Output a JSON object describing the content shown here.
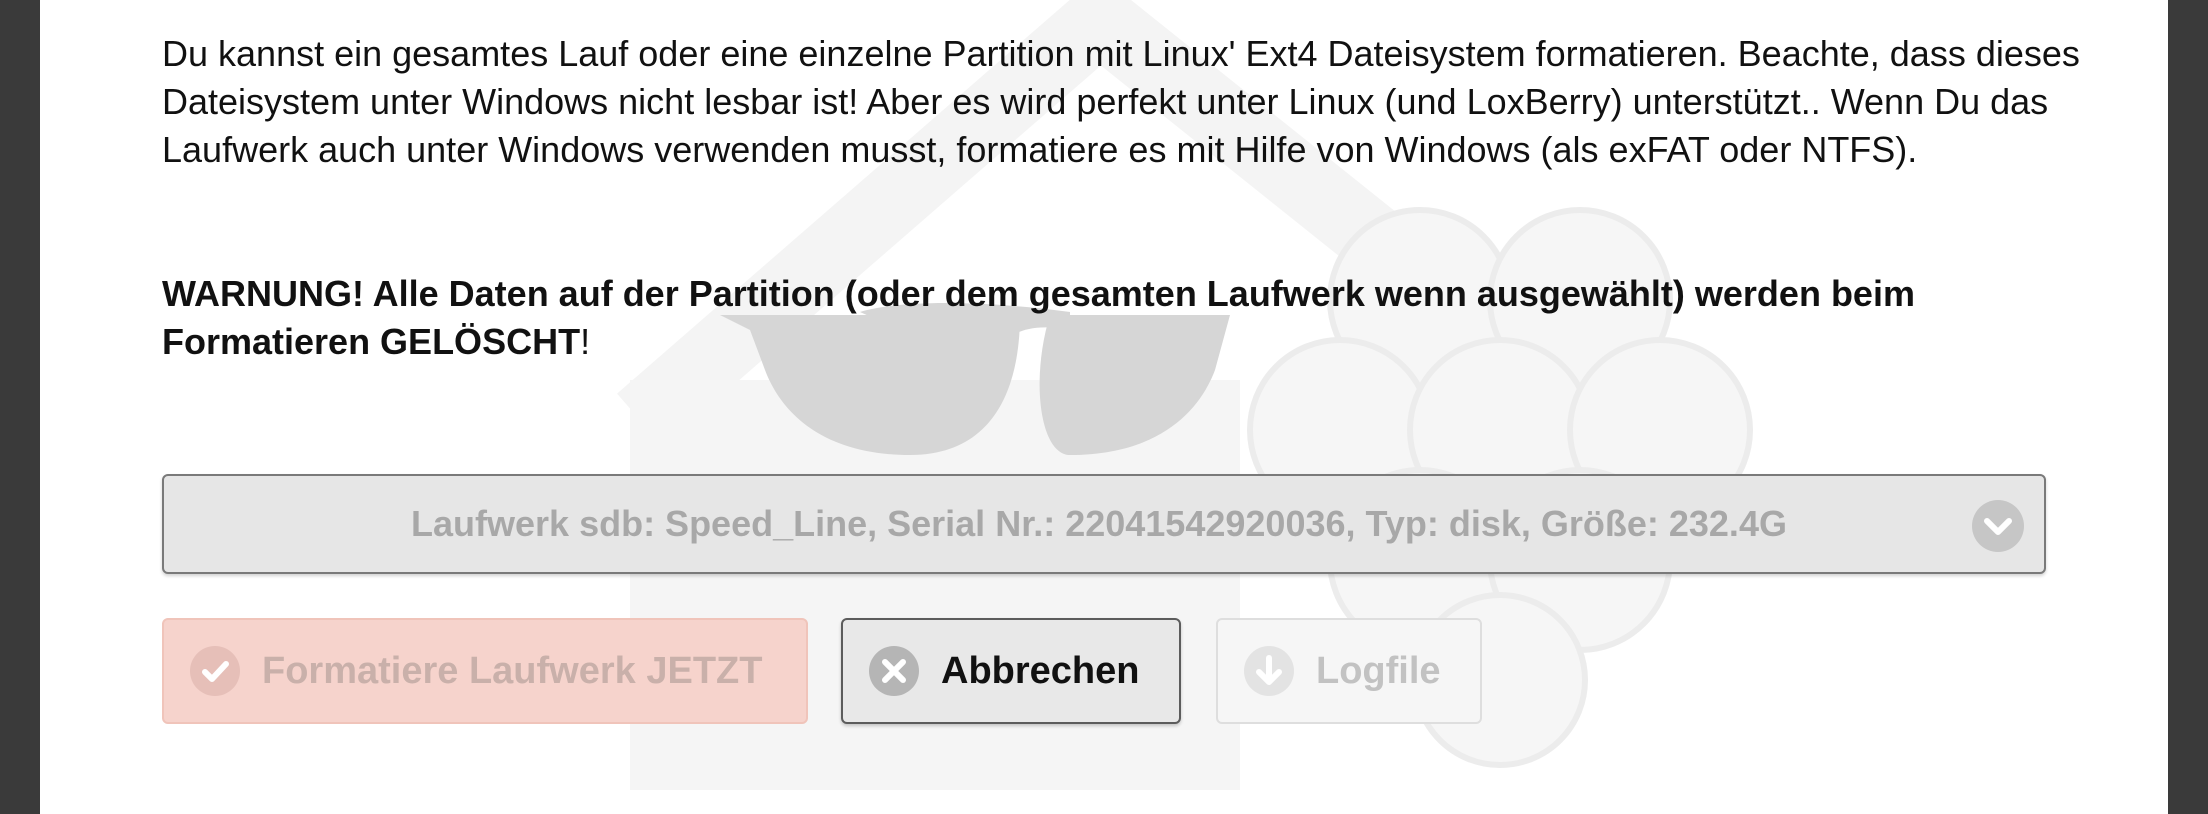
{
  "intro_text": "Du kannst ein gesamtes Lauf oder eine einzelne Partition mit Linux' Ext4 Dateisystem formatieren. Beachte, dass dieses Dateisystem unter Windows nicht lesbar ist! Aber es wird perfekt unter Linux (und LoxBerry) unterstützt.. Wenn Du das Laufwerk auch unter Windows verwenden musst, formatiere es mit Hilfe von Windows (als exFAT oder NTFS).",
  "warning": {
    "bold_text": "WARNUNG! Alle Daten auf der Partition (oder dem gesamten Laufwerk wenn ausgewählt) werden beim Formatieren GELÖSCHT",
    "suffix": "!"
  },
  "drive_select": {
    "selected_value": "Laufwerk sdb: Speed_Line, Serial Nr.: 22041542920036, Typ: disk, Größe: 232.4G",
    "icon": "chevron-down-icon"
  },
  "buttons": {
    "format_label": "Formatiere Laufwerk JETZT",
    "format_icon": "check-icon",
    "cancel_label": "Abbrechen",
    "cancel_icon": "close-icon",
    "logfile_label": "Logfile",
    "logfile_icon": "download-icon"
  },
  "colors": {
    "frame": "#3a3a3a",
    "format_button_bg": "#f6d3cc",
    "select_bg": "#e6e6e6"
  }
}
